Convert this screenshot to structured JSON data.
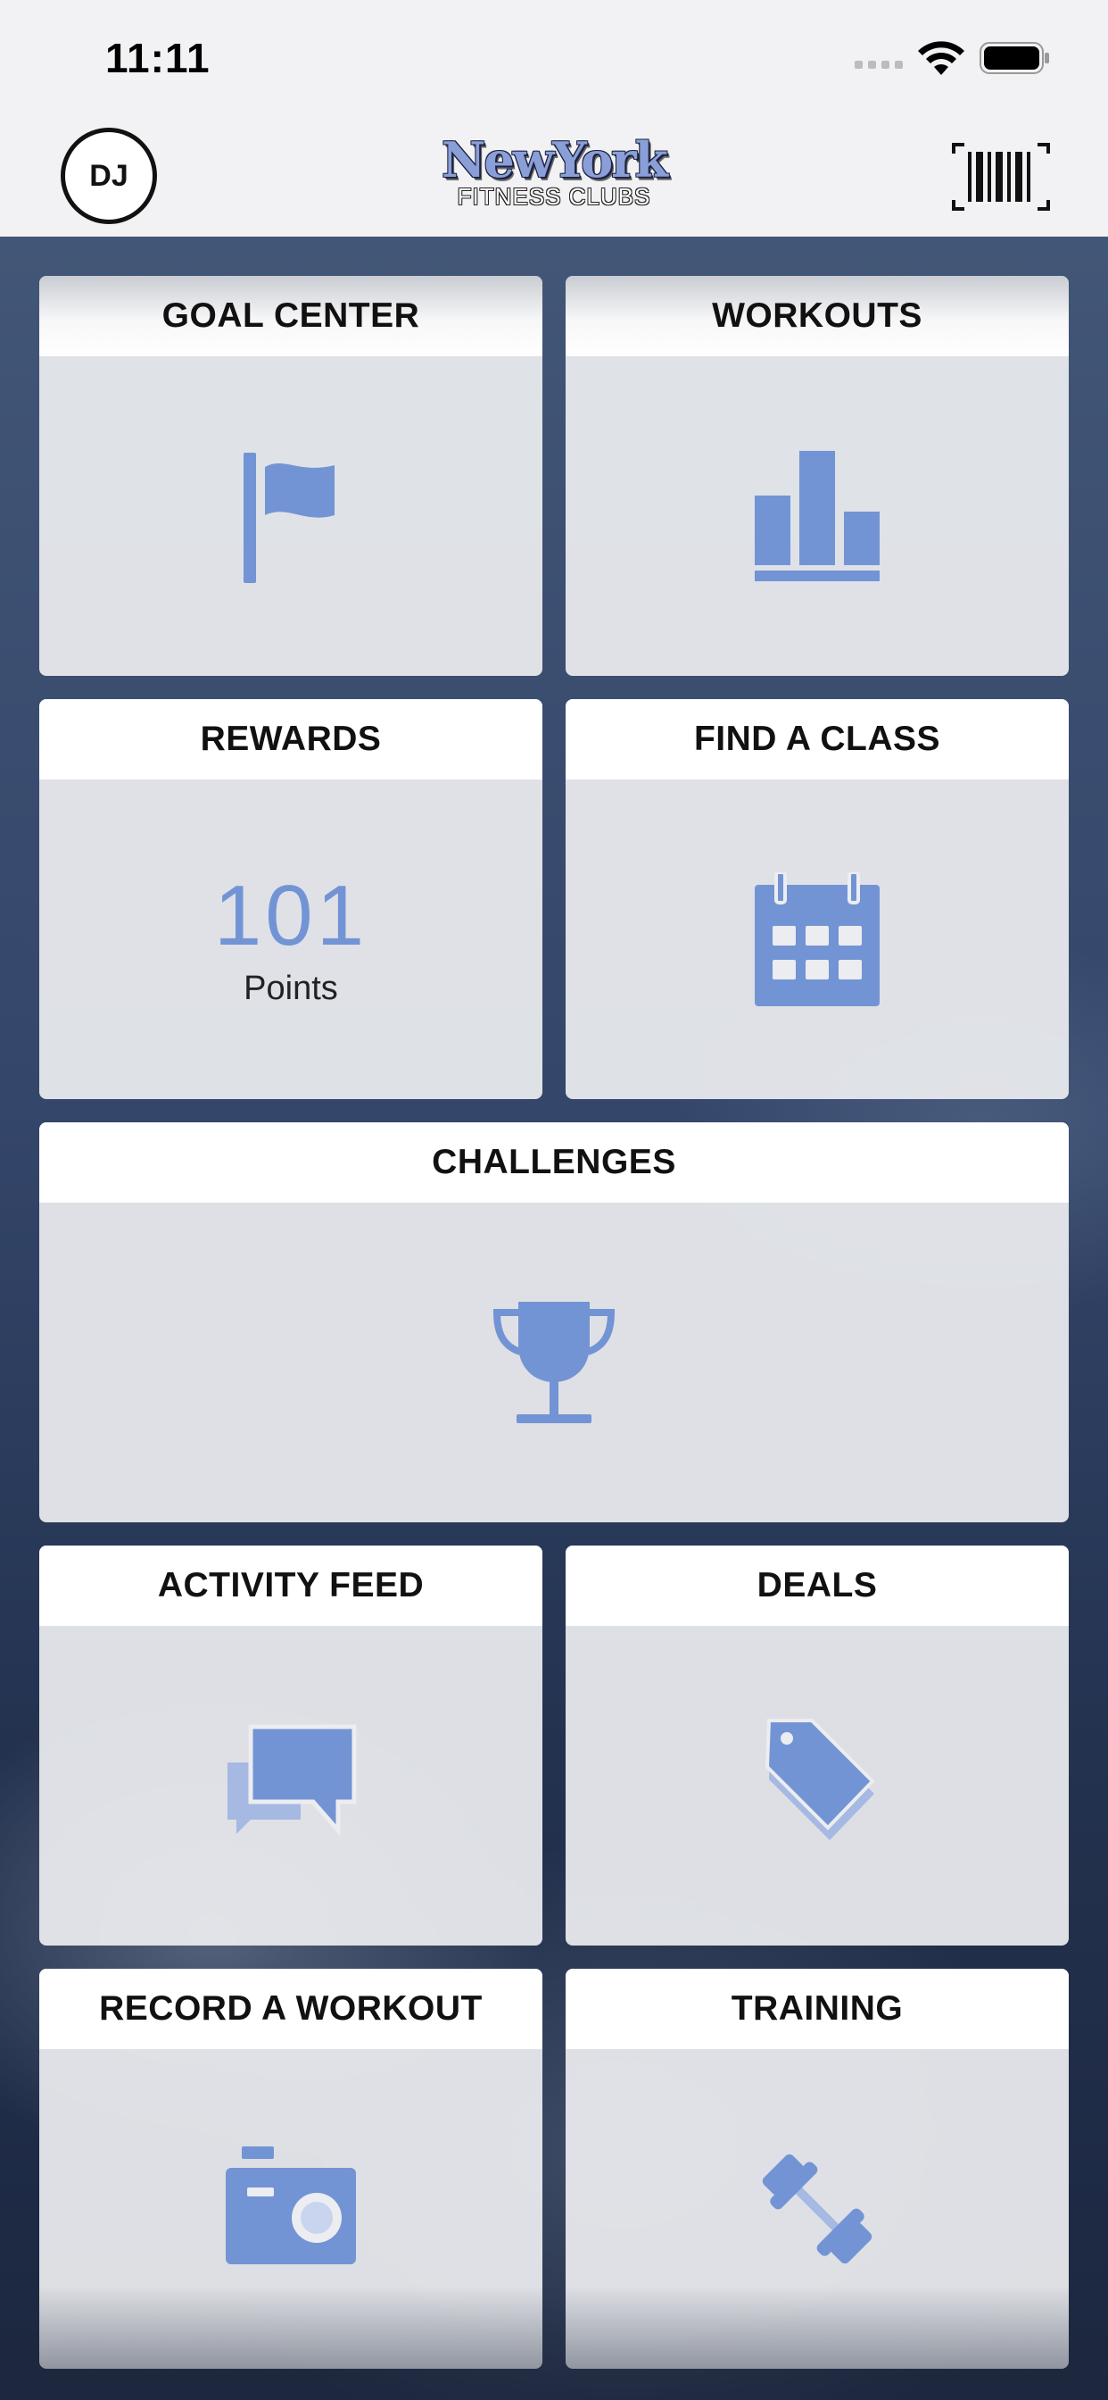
{
  "status_bar": {
    "time": "11:11"
  },
  "header": {
    "avatar_initials": "DJ",
    "logo_line1": "NewYork",
    "logo_line2": "FITNESS CLUBS",
    "barcode_icon": "barcode-icon"
  },
  "tiles": {
    "goal_center": {
      "title": "GOAL CENTER",
      "icon": "flag-icon"
    },
    "workouts": {
      "title": "WORKOUTS",
      "icon": "bar-chart-icon"
    },
    "rewards": {
      "title": "REWARDS",
      "points": "101",
      "points_label": "Points"
    },
    "find_a_class": {
      "title": "FIND A CLASS",
      "icon": "calendar-icon"
    },
    "challenges": {
      "title": "CHALLENGES",
      "icon": "trophy-icon"
    },
    "activity_feed": {
      "title": "ACTIVITY FEED",
      "icon": "chat-bubbles-icon"
    },
    "deals": {
      "title": "DEALS",
      "icon": "price-tag-icon"
    },
    "record_a_workout": {
      "title": "RECORD A WORKOUT",
      "icon": "camera-icon"
    },
    "training": {
      "title": "TRAINING",
      "icon": "dumbbell-icon"
    }
  },
  "colors": {
    "accent": "#7394d4",
    "header_bg": "#f2f2f4",
    "tile_bg": "#ecedf0",
    "title_bg": "#ffffff"
  }
}
